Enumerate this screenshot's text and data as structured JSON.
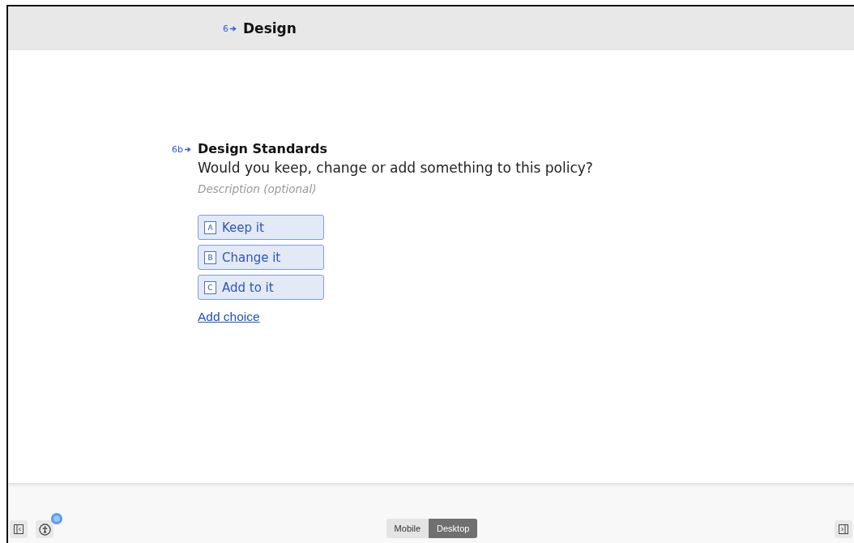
{
  "section": {
    "number": "6",
    "title": "Design"
  },
  "question": {
    "number": "6b",
    "title": "Design Standards",
    "text": "Would you keep, change or add something to this policy?",
    "description": {
      "placeholder": "Description (optional)"
    },
    "choices": [
      {
        "key": "A",
        "label": "Keep it"
      },
      {
        "key": "B",
        "label": "Change it"
      },
      {
        "key": "C",
        "label": "Add to it"
      }
    ],
    "add_choice": "Add choice"
  },
  "footer": {
    "notification": true,
    "view_tabs": [
      {
        "label": "Mobile",
        "selected": false
      },
      {
        "label": "Desktop",
        "selected": true
      }
    ]
  }
}
